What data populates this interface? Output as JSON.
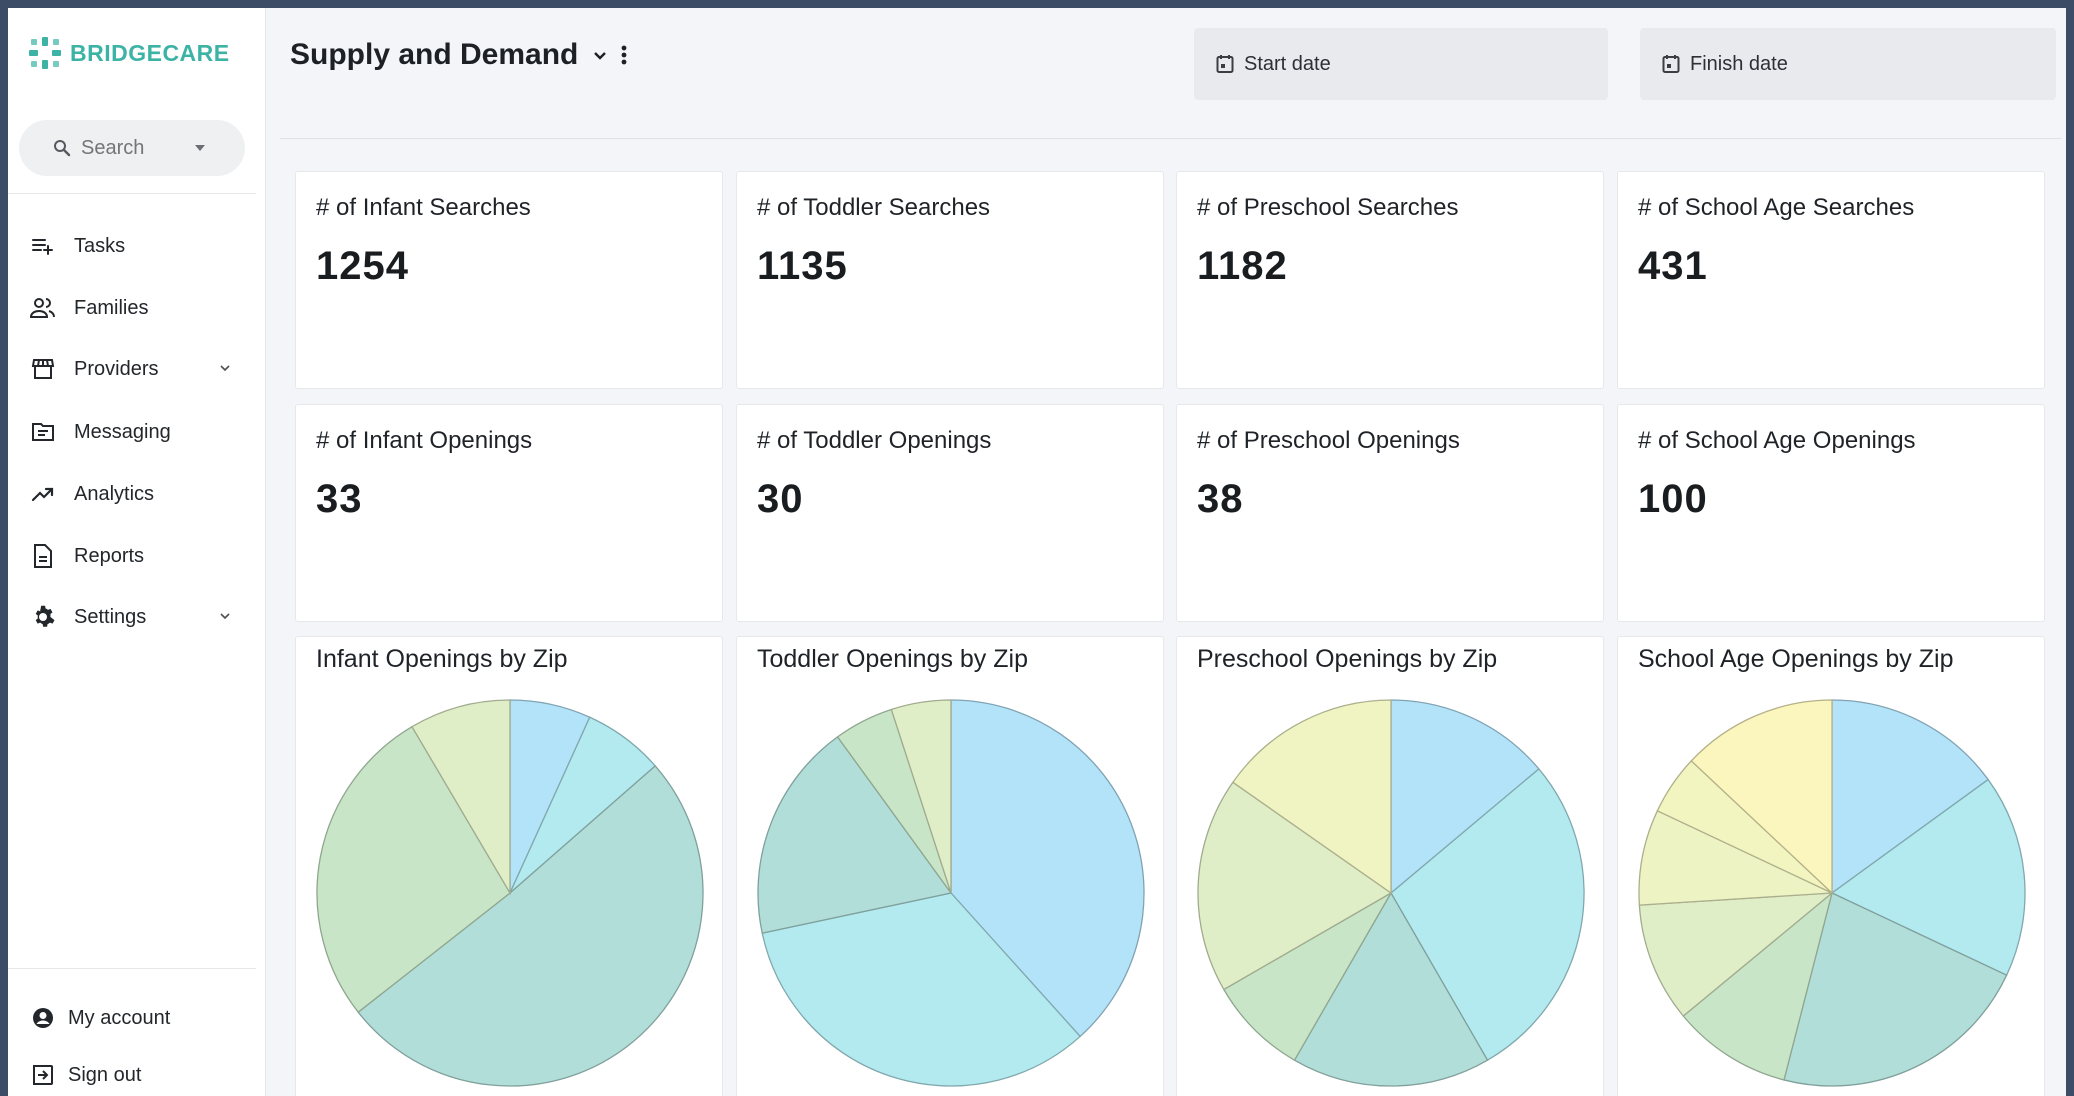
{
  "brand": {
    "name": "BRIDGECARE",
    "color": "#3cb3a4"
  },
  "search": {
    "placeholder": "Search"
  },
  "sidebar": {
    "items": [
      {
        "label": "Tasks",
        "icon": "tasks-icon"
      },
      {
        "label": "Families",
        "icon": "families-icon"
      },
      {
        "label": "Providers",
        "icon": "store-icon",
        "expandable": true
      },
      {
        "label": "Messaging",
        "icon": "messaging-icon"
      },
      {
        "label": "Analytics",
        "icon": "trending-up-icon"
      },
      {
        "label": "Reports",
        "icon": "document-icon"
      },
      {
        "label": "Settings",
        "icon": "gear-icon",
        "expandable": true
      }
    ],
    "footer": [
      {
        "label": "My account",
        "icon": "account-circle-icon"
      },
      {
        "label": "Sign out",
        "icon": "sign-out-icon"
      }
    ]
  },
  "header": {
    "title": "Supply and Demand",
    "start_date": "Start date",
    "finish_date": "Finish date"
  },
  "stats": {
    "searches": [
      {
        "label": "# of Infant Searches",
        "value": "1254"
      },
      {
        "label": "# of Toddler Searches",
        "value": "1135"
      },
      {
        "label": "# of Preschool Searches",
        "value": "1182"
      },
      {
        "label": "# of School Age Searches",
        "value": "431"
      }
    ],
    "openings": [
      {
        "label": "# of Infant Openings",
        "value": "33"
      },
      {
        "label": "# of Toddler Openings",
        "value": "30"
      },
      {
        "label": "# of Preschool Openings",
        "value": "38"
      },
      {
        "label": "# of School Age Openings",
        "value": "100"
      }
    ]
  },
  "chart_data": [
    {
      "type": "pie",
      "title": "Infant Openings by Zip",
      "values": [
        2,
        2,
        15,
        8,
        2.5
      ],
      "colors": [
        "#b3e3f8",
        "#b2eaf0",
        "#b2ded9",
        "#c8e6c7",
        "#dfeec7"
      ]
    },
    {
      "type": "pie",
      "title": "Toddler Openings by Zip",
      "values": [
        11.5,
        10,
        5.5,
        1.5,
        1.5
      ],
      "colors": [
        "#b3e3f8",
        "#b2eaf0",
        "#b2ded9",
        "#c8e6c7",
        "#dfeec7"
      ]
    },
    {
      "type": "pie",
      "title": "Preschool Openings by Zip",
      "values": [
        5,
        10,
        6,
        3,
        6.5,
        5.5
      ],
      "colors": [
        "#b3e3f8",
        "#b2eaf0",
        "#b2ded9",
        "#c8e6c7",
        "#dfeec7",
        "#eff4c2"
      ]
    },
    {
      "type": "pie",
      "title": "School Age Openings by Zip",
      "values": [
        15,
        17,
        22,
        10,
        10,
        8,
        5,
        13
      ],
      "colors": [
        "#b3e3f8",
        "#b2eaf0",
        "#b2ded9",
        "#c8e6c7",
        "#dfeec7",
        "#eef3c4",
        "#f3f5c1",
        "#fbf6bd"
      ]
    }
  ]
}
